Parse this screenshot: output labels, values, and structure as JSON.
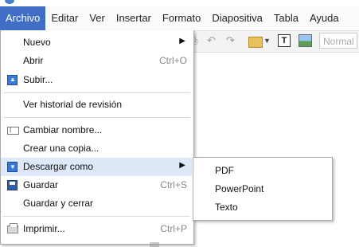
{
  "menubar": {
    "items": [
      "Archivo",
      "Editar",
      "Ver",
      "Insertar",
      "Formato",
      "Diapositiva",
      "Tabla",
      "Ayuda"
    ]
  },
  "toolbar": {
    "undo_glyph": "↶",
    "redo_glyph": "↷",
    "dropdown_glyph": "▼",
    "textbox_glyph": "T",
    "style_select": "Normal"
  },
  "file_menu": {
    "items": [
      {
        "label": "Nuevo",
        "submenu_arrow": "▶"
      },
      {
        "label": "Abrir",
        "shortcut": "Ctrl+O"
      },
      {
        "label": "Subir...",
        "icon": "upload-icon"
      },
      {
        "label": "Ver historial de revisión"
      },
      {
        "label": "Cambiar nombre...",
        "icon": "rename-icon"
      },
      {
        "label": "Crear una copia..."
      },
      {
        "label": "Descargar como",
        "icon": "download-icon",
        "submenu_arrow": "▶",
        "highlighted": true
      },
      {
        "label": "Guardar",
        "icon": "save-icon",
        "shortcut": "Ctrl+S"
      },
      {
        "label": "Guardar y cerrar"
      },
      {
        "label": "Imprimir...",
        "icon": "print-icon",
        "shortcut": "Ctrl+P"
      }
    ]
  },
  "download_submenu": {
    "items": [
      "PDF",
      "PowerPoint",
      "Texto"
    ]
  },
  "colors": {
    "active_menu": "#3f6ec4",
    "highlight_row": "#dde9f8"
  }
}
